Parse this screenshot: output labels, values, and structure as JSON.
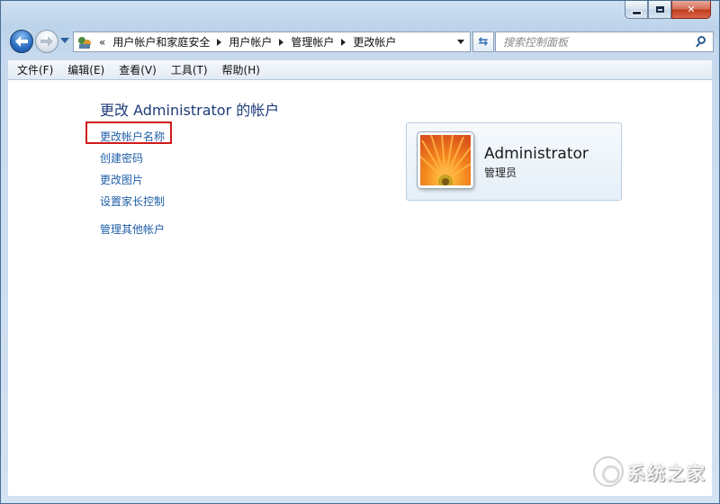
{
  "window": {
    "caption": {
      "minimize": "minimize",
      "maximize": "maximize",
      "close": "✕"
    }
  },
  "nav": {
    "address": {
      "lead": "«",
      "crumbs": [
        "用户帐户和家庭安全",
        "用户帐户",
        "管理帐户",
        "更改帐户"
      ]
    },
    "refresh_symbol": "⇆",
    "search_placeholder": "搜索控制面板"
  },
  "menubar": {
    "items": [
      "文件(F)",
      "编辑(E)",
      "查看(V)",
      "工具(T)",
      "帮助(H)"
    ]
  },
  "main": {
    "title": "更改 Administrator 的帐户",
    "tasks": [
      "更改帐户名称",
      "创建密码",
      "更改图片",
      "设置家长控制"
    ],
    "other_task": "管理其他帐户"
  },
  "account": {
    "name": "Administrator",
    "role": "管理员"
  },
  "watermark": {
    "text": "系统之家"
  },
  "colors": {
    "link": "#1f5fa8",
    "title": "#1e3c7a",
    "highlight": "#d01a1a"
  }
}
